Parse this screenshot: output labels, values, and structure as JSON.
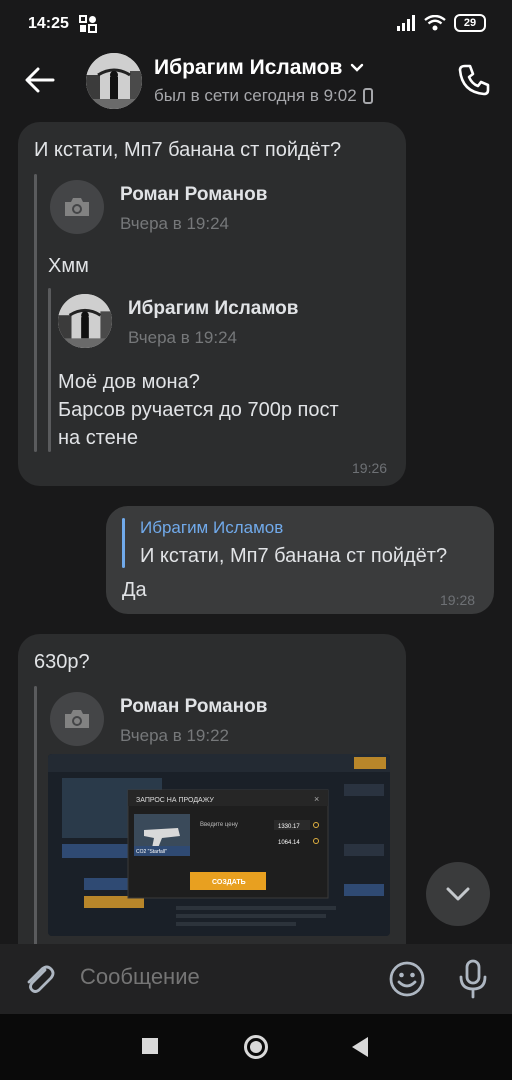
{
  "status_bar": {
    "time": "14:25",
    "battery": "29"
  },
  "header": {
    "contact_name": "Ибрагим Исламов",
    "status": "был в сети сегодня в 9:02"
  },
  "messages": [
    {
      "text": "И кстати, Мп7 банана ст пойдёт?",
      "time": "19:26",
      "forward": {
        "author": "Роман Романов",
        "date": "Вчера в 19:24",
        "text": "Хмм",
        "nested": {
          "author": "Ибрагим Исламов",
          "date": "Вчера в 19:24",
          "text_line1": "Моё дов мона?",
          "text_line2": "Барсов ручается до 700р пост",
          "text_line3": "на стене"
        }
      }
    },
    {
      "reply_author": "Ибрагим Исламов",
      "reply_text": "И кстати, Мп7 банана ст пойдёт?",
      "text": "Да",
      "time": "19:28"
    },
    {
      "text": "630р?",
      "forward": {
        "author": "Роман Романов",
        "date": "Вчера в 19:22"
      }
    }
  ],
  "screenshot_embed": {
    "dialog_title": "ЗАПРОС НА ПРОДАЖУ",
    "item_label": "CO2 \"Starfall\"",
    "price_label": "Введите цену",
    "price_value": "1330.17",
    "receive_value": "1064.14",
    "create_button": "СОЗДАТЬ"
  },
  "composer": {
    "placeholder": "Сообщение"
  }
}
